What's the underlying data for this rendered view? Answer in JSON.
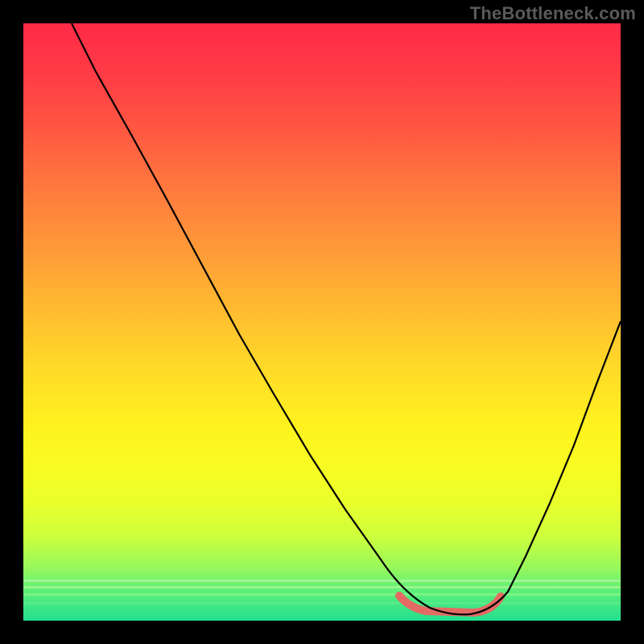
{
  "watermark": "TheBottleneck.com",
  "colors": {
    "page_bg": "#000000",
    "curve": "#000000",
    "highlight": "#e46a63",
    "gradient_top": "#ff2a47",
    "gradient_bottom": "#22e08f"
  },
  "chart_data": {
    "type": "line",
    "title": "",
    "xlabel": "",
    "ylabel": "",
    "xlim": [
      0,
      100
    ],
    "ylim": [
      0,
      100
    ],
    "axes_visible": false,
    "grid": false,
    "background": "vertical-gradient red→yellow→green (low y = green)",
    "series": [
      {
        "name": "bottleneck-curve",
        "x": [
          8,
          12,
          18,
          24,
          30,
          36,
          42,
          48,
          54,
          60,
          64,
          68,
          72,
          76,
          80,
          84,
          88,
          92,
          96,
          100
        ],
        "y": [
          100,
          92,
          81,
          70,
          59,
          48,
          38,
          28,
          19,
          10,
          5,
          2,
          1,
          1,
          2,
          5,
          11,
          20,
          30,
          41
        ]
      }
    ],
    "highlight_segment": {
      "description": "flat minimum region emphasized in salmon",
      "x_range": [
        63,
        80
      ],
      "y_approx": 1
    }
  }
}
